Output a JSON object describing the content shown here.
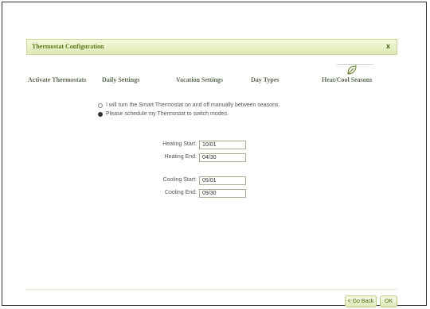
{
  "window": {
    "title": "Thermostat Configuration",
    "close_label": "x"
  },
  "tabs": [
    {
      "label": "Activate Thermostats"
    },
    {
      "label": "Daily Settings"
    },
    {
      "label": "Vacation Settings"
    },
    {
      "label": "Day Types"
    },
    {
      "label": "Heat/Cool Seasons",
      "active": true
    }
  ],
  "options": {
    "manual": {
      "label": "I will turn the Smart Thermostat on and off manually between seasons.",
      "selected": false
    },
    "schedule": {
      "label": "Please schedule my Thermostat to switch modes.",
      "selected": true
    }
  },
  "fields": {
    "heating_start": {
      "label": "Heating Start:",
      "value": "10/01"
    },
    "heating_end": {
      "label": "Heating End:",
      "value": "04/30"
    },
    "cooling_start": {
      "label": "Cooling Start:",
      "value": "05/01"
    },
    "cooling_end": {
      "label": "Cooling End:",
      "value": "09/30"
    }
  },
  "buttons": {
    "back": "< Go Back",
    "ok": "OK"
  },
  "icons": {
    "tab_indicator": "leaf-icon"
  },
  "colors": {
    "accent": "#5b7a1c",
    "titlebar": "#e8f0c6"
  }
}
